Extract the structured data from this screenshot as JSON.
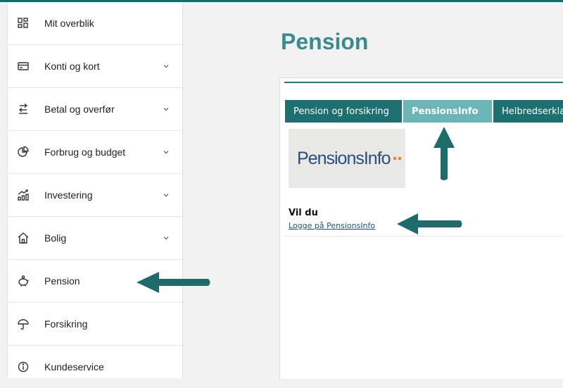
{
  "sidebar": {
    "items": [
      {
        "label": "Mit overblik",
        "icon": "dashboard-icon",
        "has_chevron": false
      },
      {
        "label": "Konti og kort",
        "icon": "card-icon",
        "has_chevron": true
      },
      {
        "label": "Betal og overfør",
        "icon": "transfer-icon",
        "has_chevron": true
      },
      {
        "label": "Forbrug og budget",
        "icon": "pie-chart-icon",
        "has_chevron": true
      },
      {
        "label": "Investering",
        "icon": "investment-chart-icon",
        "has_chevron": true
      },
      {
        "label": "Bolig",
        "icon": "house-icon",
        "has_chevron": true
      },
      {
        "label": "Pension",
        "icon": "piggy-bank-icon",
        "has_chevron": false
      },
      {
        "label": "Forsikring",
        "icon": "umbrella-icon",
        "has_chevron": false
      },
      {
        "label": "Kundeservice",
        "icon": "info-icon",
        "has_chevron": false
      }
    ]
  },
  "main": {
    "title": "Pension",
    "tabs": [
      {
        "label": "Pension og forsikring",
        "active": false
      },
      {
        "label": "PensionsInfo",
        "active": true
      },
      {
        "label": "Helbredserklæ",
        "active": false
      }
    ],
    "logo": {
      "text": "PensionsInfo",
      "icon": "pensionsinfo-logo"
    },
    "prompt": "Vil du",
    "login_link": "Logge på PensionsInfo"
  },
  "colors": {
    "accent": "#3a8a8e",
    "tab_dark": "#1e6f70",
    "tab_active": "#6cb5b7",
    "annotation_arrow": "#1e6b6b",
    "logo_text": "#2b4d80",
    "logo_dots": "#e6892e"
  }
}
